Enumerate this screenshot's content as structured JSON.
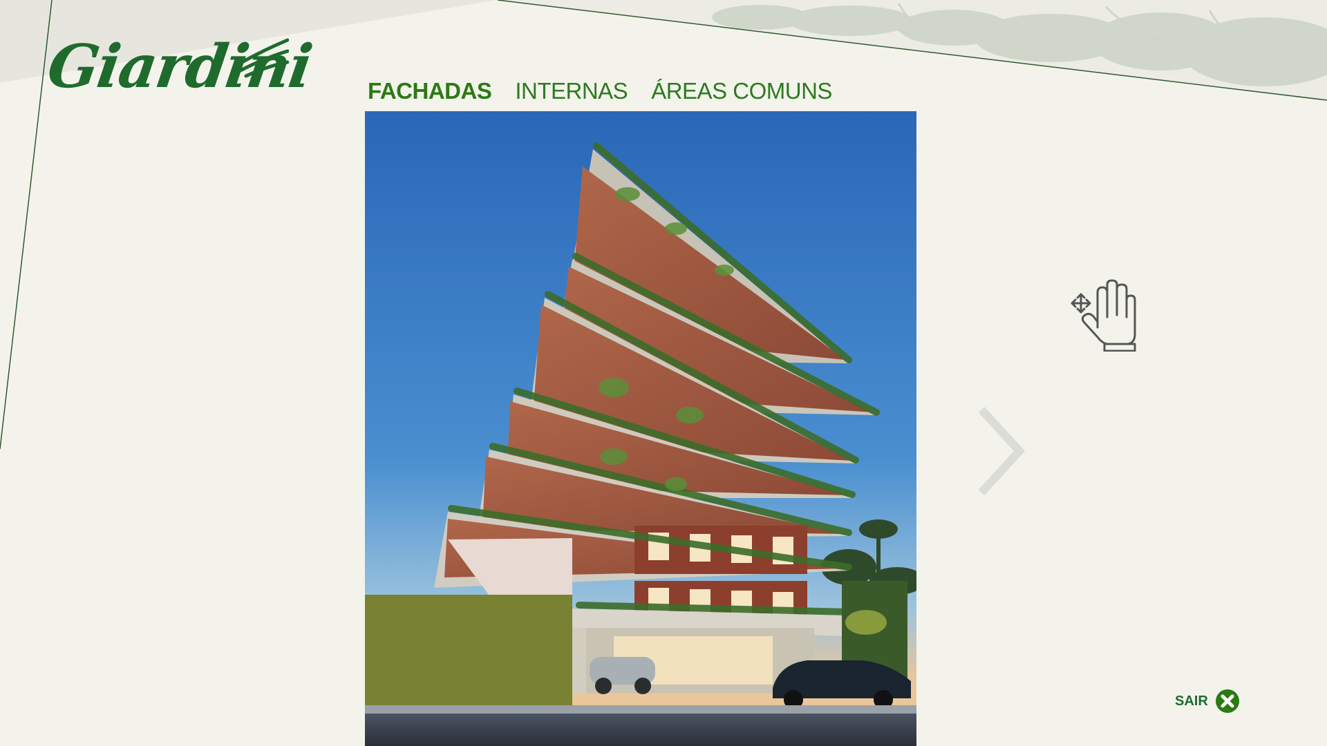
{
  "brand": {
    "logo_text": "Giardini",
    "accent_color": "#2b7a13",
    "dark_green": "#1f6b2e"
  },
  "tabs": [
    {
      "label": "FACHADAS",
      "active": true
    },
    {
      "label": "INTERNAS",
      "active": false
    },
    {
      "label": "ÁREAS COMUNS",
      "active": false
    }
  ],
  "gallery": {
    "current_image": "building-facade-render",
    "next_icon": "chevron-right-icon"
  },
  "hint": {
    "icon": "pan-hand-icon"
  },
  "exit": {
    "label": "SAIR",
    "icon": "close-circle-icon"
  }
}
